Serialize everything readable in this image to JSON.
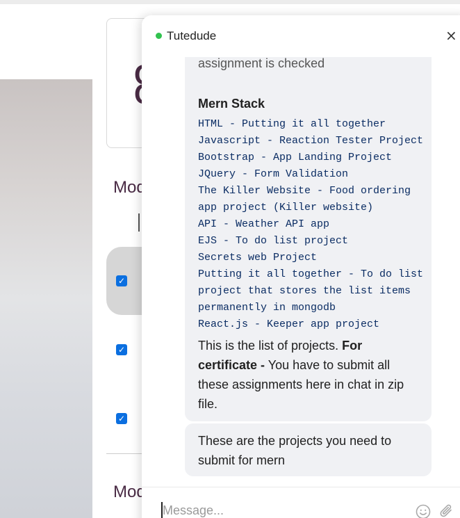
{
  "background": {
    "card_letters": [
      "C",
      "C"
    ],
    "module_labels": [
      "Mod",
      "Mod"
    ],
    "checkbox_glyph": "✓"
  },
  "chat": {
    "title": "Tutedude",
    "status_color": "#31c24f",
    "close_icon": "×",
    "messages": {
      "project_list": {
        "cut_text": "assignment is checked",
        "heading": "Mern Stack",
        "projects": [
          "HTML - Putting it all together",
          "Javascript - Reaction Tester Project",
          "Bootstrap - App Landing Project",
          "JQuery - Form Validation",
          "The Killer Website - Food ordering",
          "app project (Killer website)",
          "API - Weather API app",
          "EJS - To do list project",
          "Secrets web Project",
          "Putting it all together - To do list",
          "project that stores the list items",
          "permanently in mongodb",
          "React.js - Keeper app project"
        ],
        "footer_lines": [
          "This is the list of projects.",
          "For",
          "certificate -",
          "You have to submit all",
          "these assignments here in chat in zip",
          "file."
        ]
      },
      "second": {
        "lines": [
          "These are the projects you need to",
          "submit for mern"
        ]
      }
    },
    "composer": {
      "placeholder": "Message...",
      "value": "",
      "emoji_icon": "emoji-icon",
      "attach_icon": "paperclip-icon"
    }
  },
  "colors": {
    "bubble": "#f0f1f4",
    "project_text": "#0a2c63",
    "accent_dark": "#4a2b45",
    "checkbox": "#0b6fe0"
  }
}
